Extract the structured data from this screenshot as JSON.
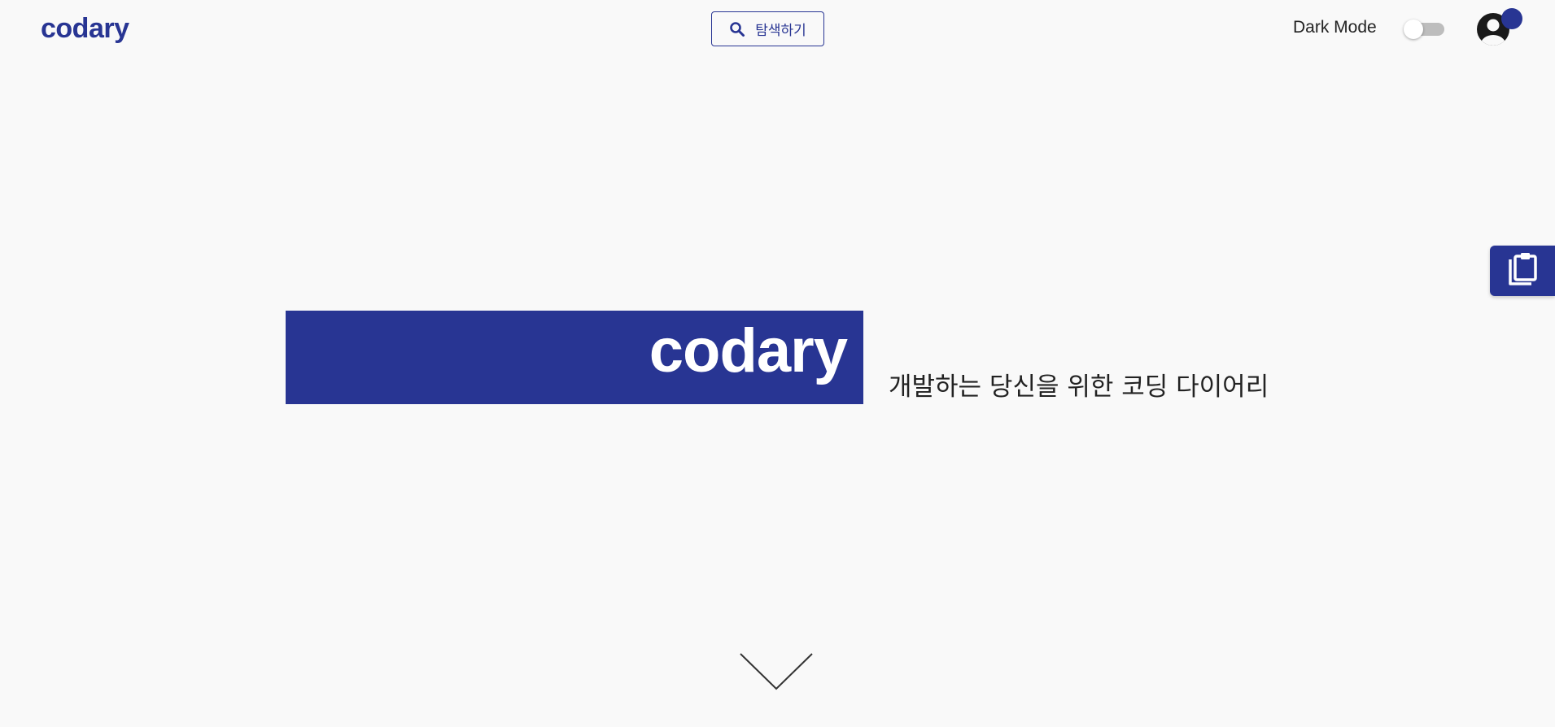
{
  "header": {
    "logo": "codary",
    "search_label": "탐색하기",
    "dark_mode_label": "Dark Mode",
    "dark_mode_enabled": false
  },
  "hero": {
    "title": "codary",
    "subtitle": "개발하는 당신을 위한 코딩 다이어리"
  },
  "icons": {
    "search": "search-icon",
    "avatar": "user-account-icon",
    "clipboard": "clipboard-icon",
    "scroll": "chevron-down-icon"
  },
  "colors": {
    "brand": "#283593",
    "background": "#f9f9f9",
    "text": "#222222"
  }
}
